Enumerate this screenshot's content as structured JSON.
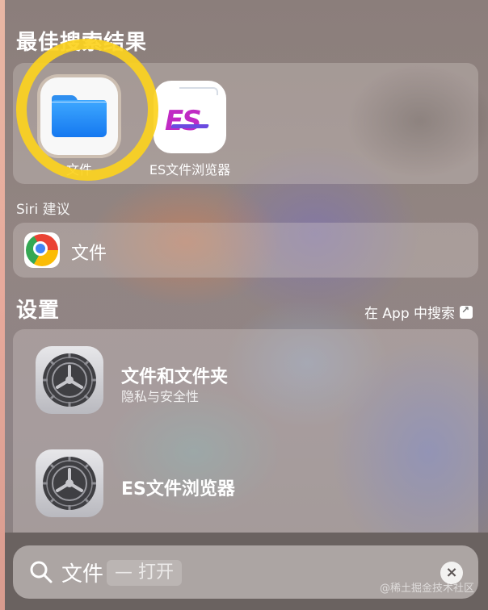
{
  "top_hits": {
    "title": "最佳搜索结果",
    "apps": [
      {
        "label": "文件",
        "icon": "files-app-icon"
      },
      {
        "label": "ES文件浏览器",
        "icon": "es-file-explorer-icon"
      }
    ]
  },
  "siri": {
    "title": "Siri 建议",
    "item_label": "文件",
    "item_icon": "chrome-icon"
  },
  "settings": {
    "title": "设置",
    "search_in_app": "在 App 中搜索",
    "items": [
      {
        "title": "文件和文件夹",
        "subtitle": "隐私与安全性"
      },
      {
        "title": "ES文件浏览器",
        "subtitle": ""
      }
    ]
  },
  "search": {
    "query": "文件",
    "hint": "— 打开"
  },
  "watermark": "@稀土掘金技术社区",
  "colors": {
    "highlight_ring": "#fcd21e",
    "folder_blue": "#1f8cf7"
  }
}
